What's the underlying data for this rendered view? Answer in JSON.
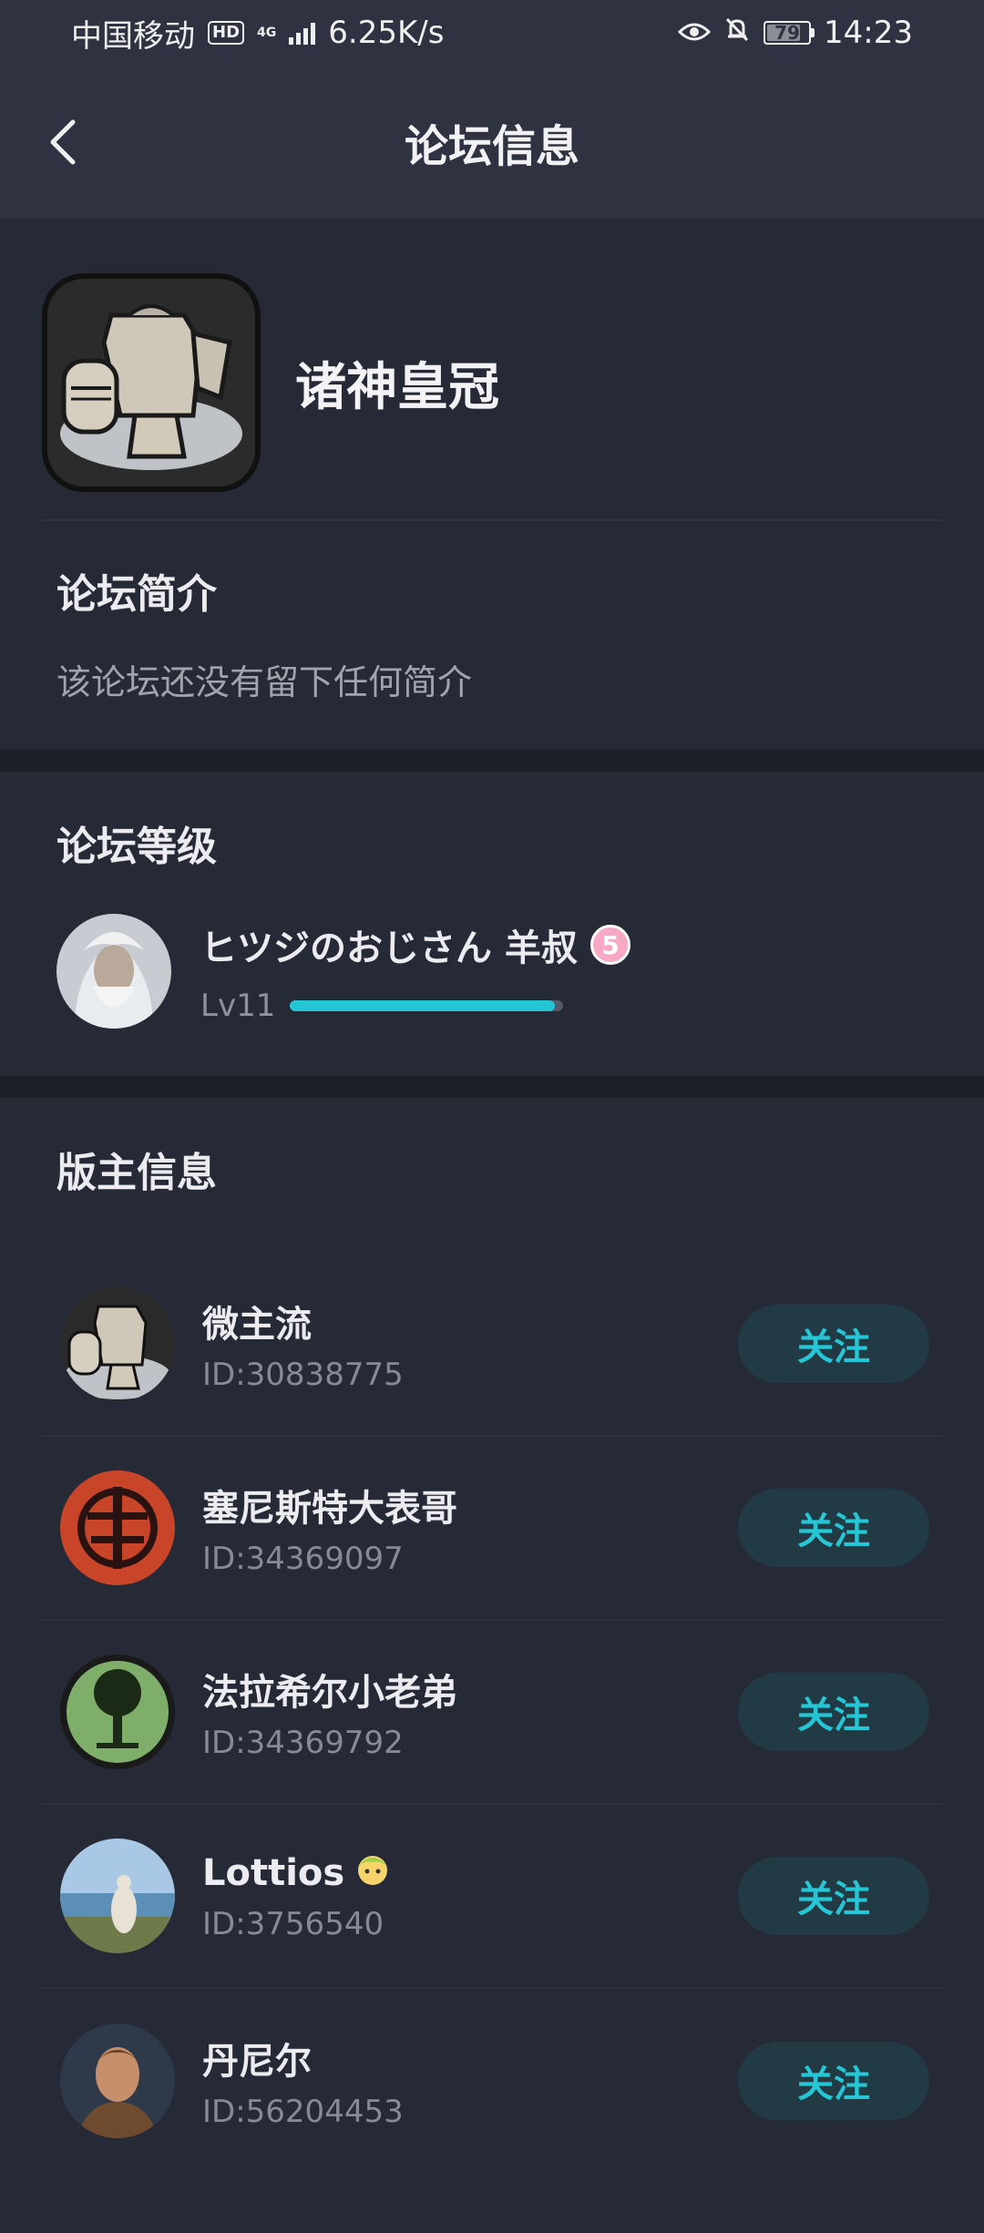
{
  "status_bar": {
    "carrier": "中国移动",
    "hd": "HD",
    "network": "4G",
    "speed": "6.25K/s",
    "battery": "79",
    "time": "14:23"
  },
  "nav": {
    "title": "论坛信息"
  },
  "forum": {
    "name": "诸神皇冠"
  },
  "intro": {
    "title": "论坛简介",
    "text": "该论坛还没有留下任何简介"
  },
  "level": {
    "title": "论坛等级",
    "user_name": "ヒツジのおじさん 羊叔",
    "badge": "5",
    "lv_label": "Lv11",
    "progress": 0.97
  },
  "moderators": {
    "title": "版主信息",
    "follow_label": "关注",
    "items": [
      {
        "name": "微主流",
        "id": "ID:30838775"
      },
      {
        "name": "塞尼斯特大表哥",
        "id": "ID:34369097"
      },
      {
        "name": "法拉希尔小老弟",
        "id": "ID:34369792"
      },
      {
        "name": "Lottios",
        "id": "ID:3756540"
      },
      {
        "name": "丹尼尔",
        "id": "ID:56204453"
      }
    ]
  },
  "colors": {
    "accent": "#24c6d6",
    "background": "#232530",
    "header": "#2f3341"
  }
}
